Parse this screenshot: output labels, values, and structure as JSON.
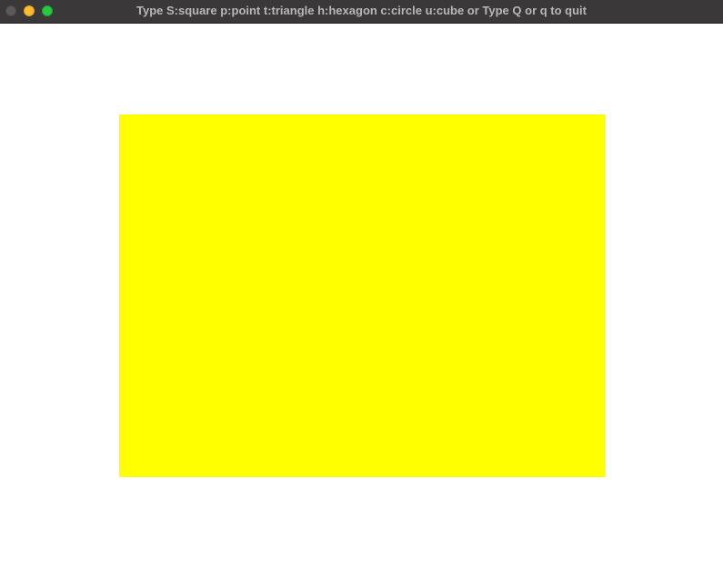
{
  "window": {
    "title": "Type S:square p:point t:triangle h:hexagon c:circle u:cube or Type Q or q to quit",
    "controls": {
      "close": {
        "icon": "close-icon",
        "color": "#5b595a",
        "border": "#4a4849"
      },
      "minimize": {
        "icon": "minimize-icon",
        "color": "#febc2e",
        "border": "#d89e24"
      },
      "zoom": {
        "icon": "zoom-icon",
        "color": "#28c840",
        "border": "#1ea333"
      }
    }
  },
  "canvas": {
    "background": "#ffffff",
    "shape": {
      "type": "square",
      "fill": "#ffff00"
    }
  }
}
